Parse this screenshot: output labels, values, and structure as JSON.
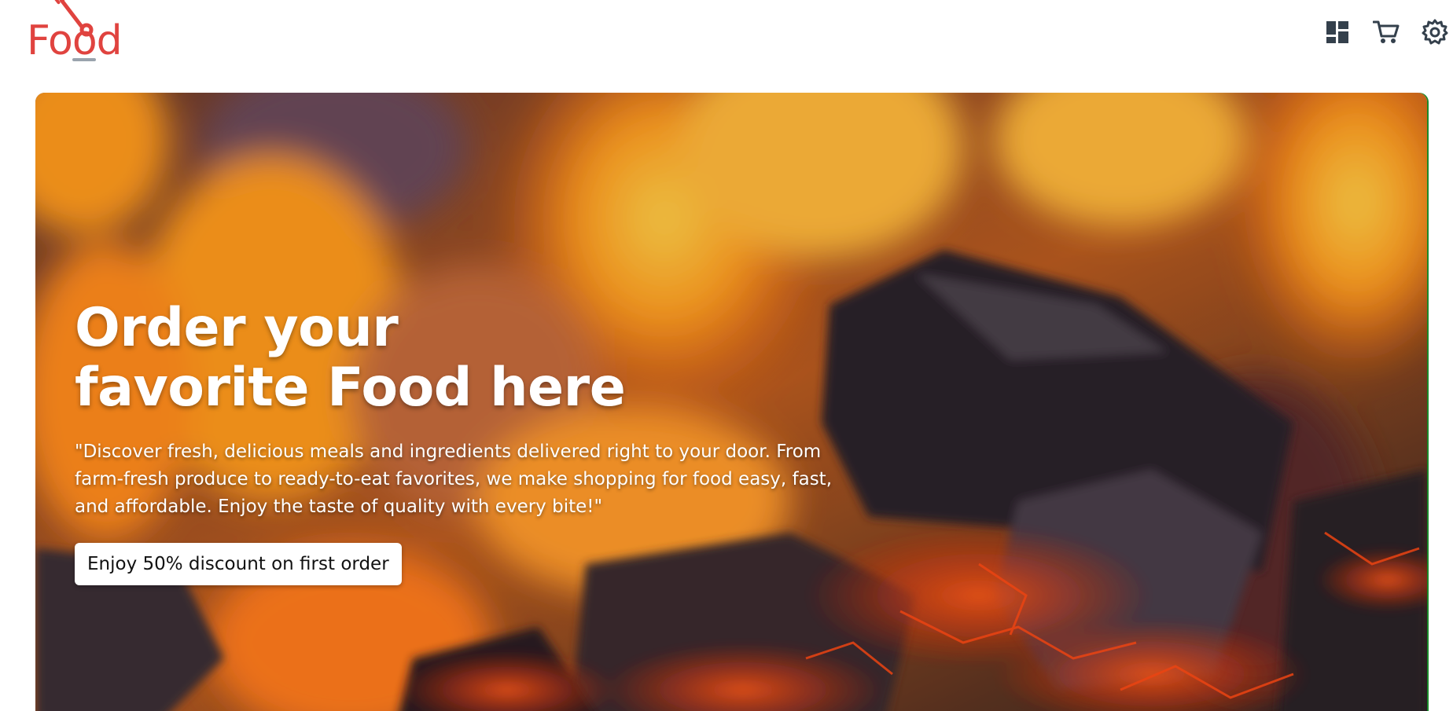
{
  "header": {
    "logo_text": "Food",
    "brand_color": "#e0433f",
    "icons": [
      "dashboard-icon",
      "cart-icon",
      "settings-icon"
    ],
    "icon_color": "#34404c"
  },
  "hero": {
    "title": "Order your\nfavorite Food here",
    "description": "\"Discover fresh, delicious meals and ingredients delivered right to your door. From farm-fresh produce to ready-to-eat favorites, we make shopping for food easy, fast, and affordable. Enjoy the taste of quality with every bite!\"",
    "cta_label": "Enjoy 50% discount on first order",
    "background": "fire-and-charcoal-image"
  }
}
